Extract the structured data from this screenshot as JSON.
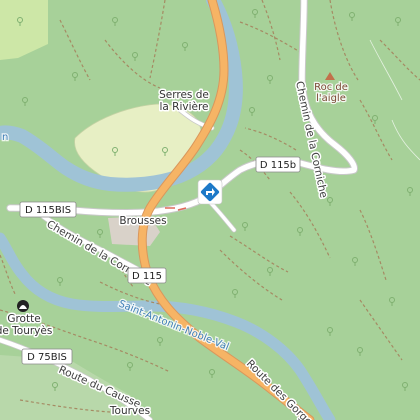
{
  "map": {
    "places": {
      "serres": [
        "Serres de",
        "la Rivière"
      ],
      "brousses": "Brousses",
      "grotte": [
        "Grotte",
        "de Touryès"
      ],
      "tourves": "Tourves"
    },
    "peak": [
      "Roc de",
      "l'aigle"
    ],
    "roads": {
      "chemin_corniche_top": "Chemin de la Corniche",
      "chemin_corniche_left": "Chemin de la Corniche",
      "route_gorges": "Route des Gorges",
      "route_causse": "Route du Causse"
    },
    "shields": {
      "d115b": "D 115b",
      "d115bis": "D 115BIS",
      "d115": "D 115",
      "d75bis": "D 75BIS"
    },
    "water": {
      "river_label": "Saint-Antonin-Noble-Val",
      "edge_label": "n"
    },
    "icons": {
      "junction": "directions-diamond-icon",
      "peak": "peak-triangle-icon",
      "cave": "cave-icon",
      "tree": "tree-icon"
    },
    "colors": {
      "background": "#a7d199",
      "meadow": "#e7efc4",
      "field": "#cde7a7",
      "river": "#9fc3d6",
      "main_road": "#f6b465",
      "main_road_casing": "#d9975c",
      "minor_road": "#ffffff",
      "track": "#a58a63",
      "junction_marker": "#1d79c8"
    }
  }
}
